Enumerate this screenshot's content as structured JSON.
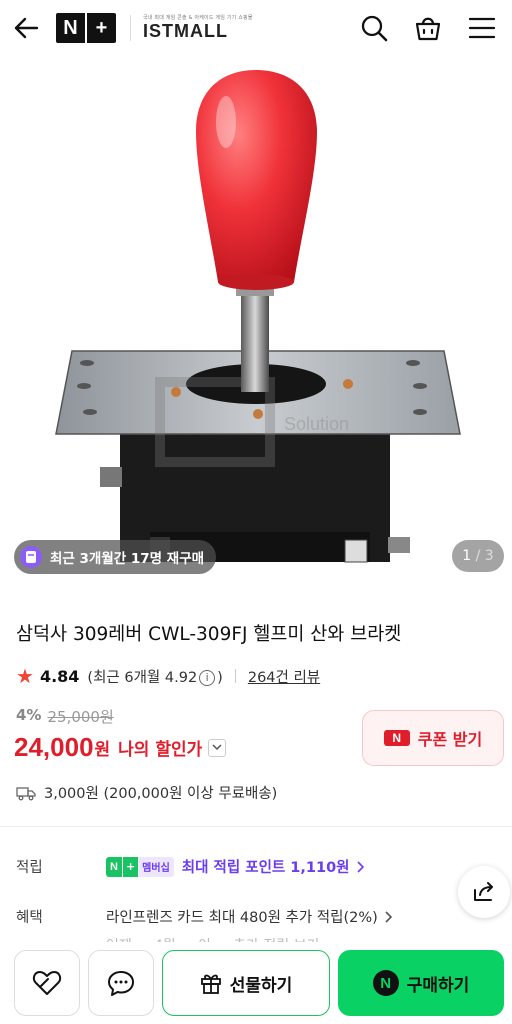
{
  "header": {
    "brand_n": "N",
    "brand_plus": "+",
    "store_tagline": "국내 최대 게임 콘솔 & 아케이드 게임 기기 쇼핑몰",
    "store_name": "ISTMALL",
    "icons": [
      "back-arrow-icon",
      "search-icon",
      "basket-icon",
      "hamburger-menu-icon"
    ]
  },
  "gallery": {
    "watermark": "Solution",
    "repurchase_text": "최근 3개월간 17명 재구매",
    "page_current": "1",
    "page_total": "/ 3",
    "accent_color": "#e8302f"
  },
  "product": {
    "title": "삼덕사 309레버 CWL-309FJ 헬프미 산와 브라켓",
    "rating": "4.84",
    "recent_rating_prefix": "(최근 6개월 4.92",
    "recent_rating_suffix": ")",
    "info_icon_glyph": "i",
    "review_count": "264건 리뷰",
    "discount_rate": "4%",
    "original_price": "25,000원",
    "sale_price": "24,000",
    "currency": "원",
    "my_discount_label": "나의 할인가",
    "coupon_badge": "N",
    "coupon_label": "쿠폰 받기",
    "shipping": "3,000원 (200,000원 이상 무료배송)"
  },
  "benefits": {
    "points_label": "적립",
    "badge_n": "N",
    "badge_plus": "+",
    "badge_membership": "멤버십",
    "points_text": "최대 적립 포인트 1,110원",
    "benefit_label": "혜택",
    "card_benefit": "라인프렌즈 카드 최대 480원 추가 적립(2%)",
    "faded_text": "어제 ... 4월 ... 이 ... 추가 적립 보기"
  },
  "bottom_bar": {
    "gift_label": "선물하기",
    "buy_badge": "N",
    "buy_label": "구매하기"
  },
  "colors": {
    "brand_green": "#09d163",
    "price_red": "#e01e2b",
    "points_purple": "#6b3df0"
  }
}
